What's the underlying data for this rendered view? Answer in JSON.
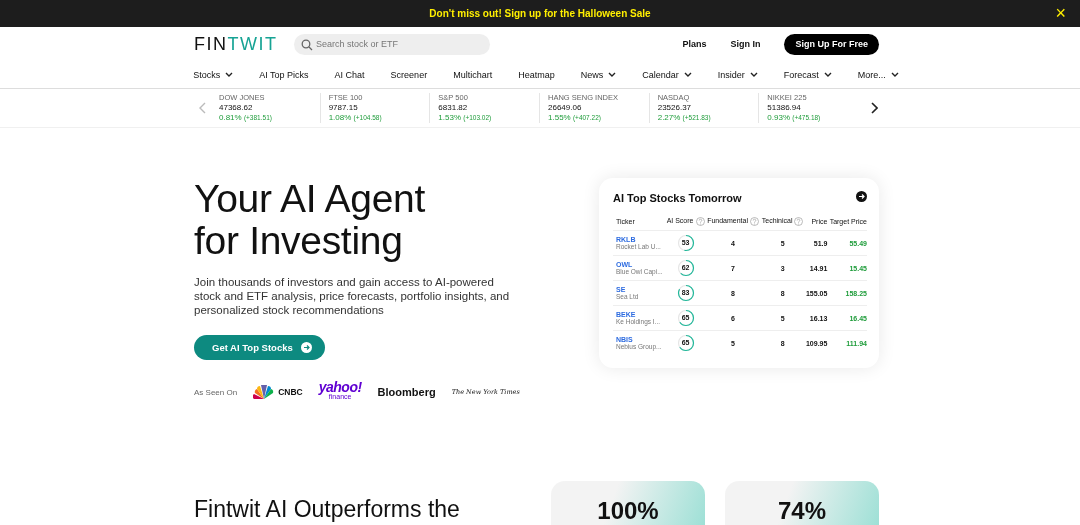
{
  "promo_banner": {
    "text": "Don't miss out! Sign up for the Halloween Sale",
    "close": "×"
  },
  "header": {
    "logo": {
      "part_1": "FIN",
      "part_2": "TWIT"
    },
    "search": {
      "placeholder": "Search stock or ETF"
    },
    "links": [
      "Plans",
      "Sign In"
    ],
    "signup_button": "Sign Up For Free"
  },
  "nav": [
    {
      "label": "Stocks",
      "dropdown": true
    },
    {
      "label": "AI Top Picks",
      "dropdown": false
    },
    {
      "label": "AI Chat",
      "dropdown": false
    },
    {
      "label": "Screener",
      "dropdown": false
    },
    {
      "label": "Multichart",
      "dropdown": false
    },
    {
      "label": "Heatmap",
      "dropdown": false
    },
    {
      "label": "News",
      "dropdown": true
    },
    {
      "label": "Calendar",
      "dropdown": true
    },
    {
      "label": "Insider",
      "dropdown": true
    },
    {
      "label": "Forecast",
      "dropdown": true
    },
    {
      "label": "More...",
      "dropdown": true
    }
  ],
  "tickers": [
    {
      "name": "DOW JONES",
      "value": "47368.62",
      "change": "0.81%",
      "delta": "(+381.51)"
    },
    {
      "name": "FTSE 100",
      "value": "9787.15",
      "change": "1.08%",
      "delta": "(+104.58)"
    },
    {
      "name": "S&P 500",
      "value": "6831.82",
      "change": "1.53%",
      "delta": "(+103.02)"
    },
    {
      "name": "HANG SENG INDEX",
      "value": "26649.06",
      "change": "1.55%",
      "delta": "(+407.22)"
    },
    {
      "name": "NASDAQ",
      "value": "23526.37",
      "change": "2.27%",
      "delta": "(+521.83)"
    },
    {
      "name": "NIKKEI 225",
      "value": "51386.94",
      "change": "0.93%",
      "delta": "(+475.18)"
    }
  ],
  "hero": {
    "title_line_1": "Your AI Agent",
    "title_line_2": "for Investing",
    "description": "Join thousands of investors and gain access to AI-powered stock and ETF analysis, price forecasts, portfolio insights, and personalized stock recommendations",
    "cta": "Get AI Top Stocks",
    "as_seen_on": "As Seen On",
    "media": [
      {
        "kind": "cnbc",
        "text": "CNBC"
      },
      {
        "kind": "yahoo",
        "text": "yahoo!",
        "sub": "finance"
      },
      {
        "kind": "bloomberg",
        "text": "Bloomberg"
      },
      {
        "kind": "nyt",
        "text": "The New York Times"
      }
    ]
  },
  "top_stocks": {
    "title": "AI Top Stocks Tomorrow",
    "columns": [
      {
        "label": "Ticker",
        "help": false
      },
      {
        "label": "AI Score",
        "help": true
      },
      {
        "label": "Fundamental",
        "help": true
      },
      {
        "label": "Techinical",
        "help": true
      },
      {
        "label": "Price",
        "help": false
      },
      {
        "label": "Target Price",
        "help": false
      }
    ],
    "rows": [
      {
        "ticker": "RKLB",
        "company": "Rocket Lab U...",
        "score": "53",
        "fundamental": "4",
        "technical": "5",
        "price": "51.9",
        "target": "55.49"
      },
      {
        "ticker": "OWL",
        "company": "Blue Owl Capi...",
        "score": "62",
        "fundamental": "7",
        "technical": "3",
        "price": "14.91",
        "target": "15.45"
      },
      {
        "ticker": "SE",
        "company": "Sea Ltd",
        "score": "83",
        "fundamental": "8",
        "technical": "8",
        "price": "155.05",
        "target": "158.25"
      },
      {
        "ticker": "BEKE",
        "company": "Ke Holdings I...",
        "score": "65",
        "fundamental": "6",
        "technical": "5",
        "price": "16.13",
        "target": "16.45"
      },
      {
        "ticker": "NBIS",
        "company": "Nebius Group...",
        "score": "65",
        "fundamental": "5",
        "technical": "8",
        "price": "109.95",
        "target": "111.94"
      }
    ]
  },
  "outperforms": {
    "heading": "Fintwit AI Outperforms the",
    "stats": [
      "100%",
      "74%"
    ]
  }
}
